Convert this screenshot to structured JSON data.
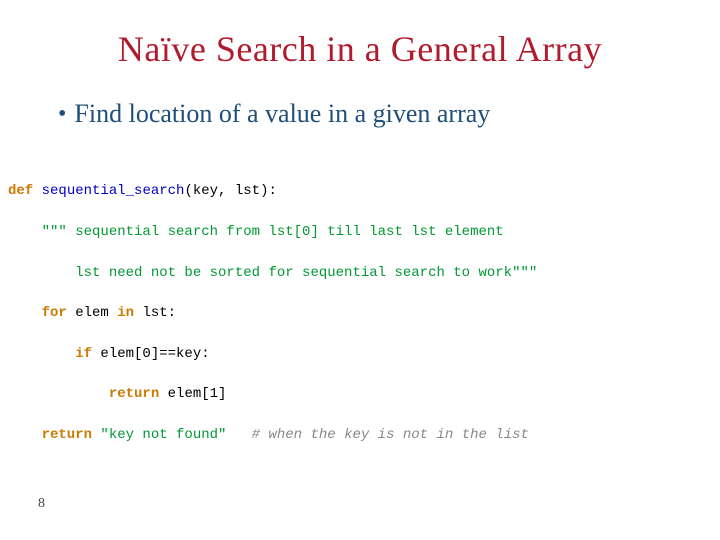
{
  "title": "Naïve Search in a General Array",
  "bullet": "Find location of a value in a given array",
  "page_number": "8",
  "code": {
    "l1_def": "def",
    "l1_fn": "sequential_search",
    "l1_rest": "(key, lst):",
    "l2": "    \"\"\" sequential search from lst[0] till last lst element",
    "l3": "        lst need not be sorted for sequential search to work\"\"\"",
    "l4_for": "    for",
    "l4_mid": " elem ",
    "l4_in": "in",
    "l4_rest": " lst:",
    "l5_if": "        if",
    "l5_rest": " elem[0]==key:",
    "l6_ret": "            return",
    "l6_rest": " elem[1]",
    "l7_ret": "    return",
    "l7_str": " \"key not found\"",
    "l7_sp": "   ",
    "l7_comment": "# when the key is not in the list"
  }
}
